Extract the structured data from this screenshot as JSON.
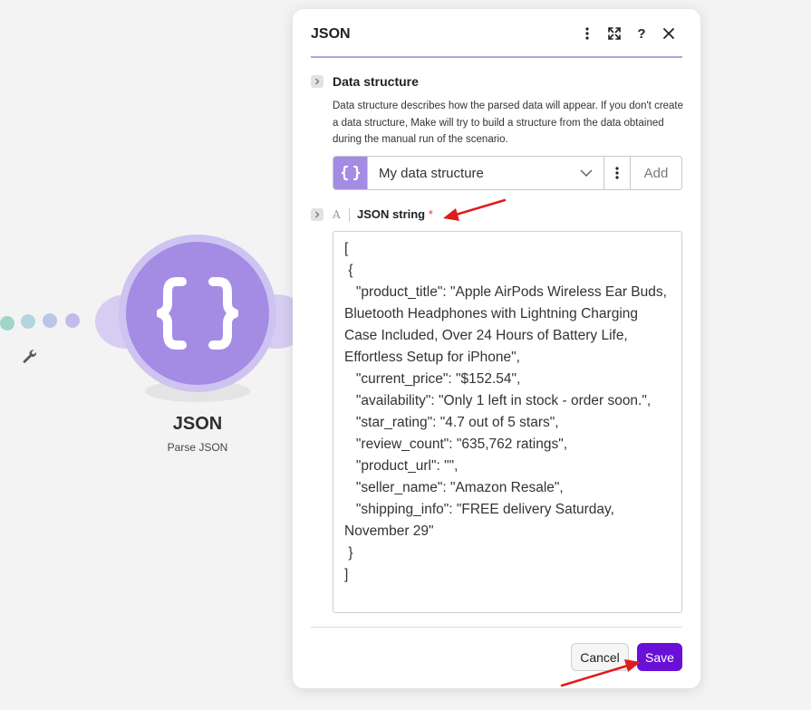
{
  "canvas": {
    "module": {
      "title": "JSON",
      "subtitle": "Parse JSON",
      "icon": "curly-braces-icon",
      "accent": "#a48be4"
    },
    "connector_icon": "wrench-icon"
  },
  "panel": {
    "title": "JSON",
    "header_icons": [
      "more-vertical-icon",
      "expand-icon",
      "help-icon",
      "close-icon"
    ],
    "help_label": "?",
    "data_structure": {
      "label": "Data structure",
      "description": "Data structure describes how the parsed data will appear. If you don't create a data structure, Make will try to build a structure from the data obtained during the manual run of the scenario.",
      "selected": "My data structure",
      "add_label": "Add"
    },
    "json_string": {
      "type_icon": "A",
      "label": "JSON string",
      "required_mark": "*",
      "value": "[\n {\n   \"product_title\": \"Apple AirPods Wireless Ear Buds, Bluetooth Headphones with Lightning Charging Case Included, Over 24 Hours of Battery Life, Effortless Setup for iPhone\",\n   \"current_price\": \"$152.54\",\n   \"availability\": \"Only 1 left in stock - order soon.\",\n   \"star_rating\": \"4.7 out of 5 stars\",\n   \"review_count\": \"635,762 ratings\",\n   \"product_url\": \"\",\n   \"seller_name\": \"Amazon Resale\",\n   \"shipping_info\": \"FREE delivery Saturday, November 29\"\n }\n]"
    },
    "buttons": {
      "cancel": "Cancel",
      "save": "Save"
    }
  },
  "colors": {
    "save_button": "#6a0fd8",
    "annotation_arrow": "#e01b1b"
  }
}
